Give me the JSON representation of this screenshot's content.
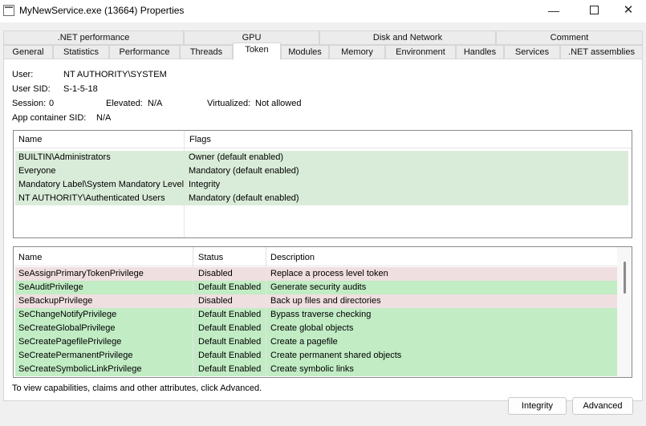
{
  "window": {
    "title": "MyNewService.exe (13664) Properties",
    "minimize_glyph": "—",
    "close_glyph": "✕",
    "app_icon": "window-icon",
    "controls": [
      "minimize-icon",
      "maximize-icon",
      "close-icon"
    ]
  },
  "tabs": {
    "row1": [
      ".NET performance",
      "GPU",
      "Disk and Network",
      "Comment"
    ],
    "row2": [
      "General",
      "Statistics",
      "Performance",
      "Threads",
      "Token",
      "Modules",
      "Memory",
      "Environment",
      "Handles",
      "Services",
      ".NET assemblies"
    ],
    "active": "Token"
  },
  "token": {
    "user_label": "User:",
    "user_value": "NT AUTHORITY\\SYSTEM",
    "sid_label": "User SID:",
    "sid_value": "S-1-5-18",
    "session_label": "Session:",
    "session_value": "0",
    "elevated_label": "Elevated:",
    "elevated_value": "N/A",
    "virtualized_label": "Virtualized:",
    "virtualized_value": "Not allowed",
    "appcontainer_label": "App container SID:",
    "appcontainer_value": "N/A"
  },
  "groups": {
    "columns": [
      "Name",
      "Flags"
    ],
    "rows": [
      {
        "name": "BUILTIN\\Administrators",
        "flags": "Owner (default enabled)"
      },
      {
        "name": "Everyone",
        "flags": "Mandatory (default enabled)"
      },
      {
        "name": "Mandatory Label\\System Mandatory Level",
        "flags": "Integrity"
      },
      {
        "name": "NT AUTHORITY\\Authenticated Users",
        "flags": "Mandatory (default enabled)"
      }
    ]
  },
  "privileges": {
    "columns": [
      "Name",
      "Status",
      "Description"
    ],
    "rows": [
      {
        "name": "SeAssignPrimaryTokenPrivilege",
        "status": "Disabled",
        "description": "Replace a process level token"
      },
      {
        "name": "SeAuditPrivilege",
        "status": "Default Enabled",
        "description": "Generate security audits"
      },
      {
        "name": "SeBackupPrivilege",
        "status": "Disabled",
        "description": "Back up files and directories"
      },
      {
        "name": "SeChangeNotifyPrivilege",
        "status": "Default Enabled",
        "description": "Bypass traverse checking"
      },
      {
        "name": "SeCreateGlobalPrivilege",
        "status": "Default Enabled",
        "description": "Create global objects"
      },
      {
        "name": "SeCreatePagefilePrivilege",
        "status": "Default Enabled",
        "description": "Create a pagefile"
      },
      {
        "name": "SeCreatePermanentPrivilege",
        "status": "Default Enabled",
        "description": "Create permanent shared objects"
      },
      {
        "name": "SeCreateSymbolicLinkPrivilege",
        "status": "Default Enabled",
        "description": "Create symbolic links"
      }
    ]
  },
  "colors": {
    "enabled": "#c1ecc4",
    "disabled": "#f0dfe1",
    "group_row": "#d9ecd9"
  },
  "footer": {
    "hint": "To view capabilities, claims and other attributes, click Advanced.",
    "integrity_button": "Integrity",
    "advanced_button": "Advanced"
  }
}
